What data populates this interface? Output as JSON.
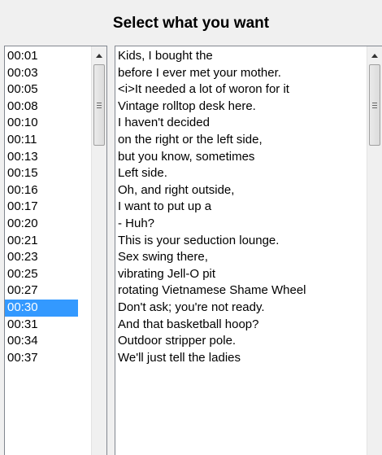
{
  "dialog": {
    "title": "Select what you want"
  },
  "selected_index": 15,
  "times": [
    "00:01",
    "00:03",
    "00:05",
    "00:08",
    "00:10",
    "00:11",
    "00:13",
    "00:15",
    "00:16",
    "00:17",
    "00:20",
    "00:21",
    "00:23",
    "00:25",
    "00:27",
    "00:30",
    "00:31",
    "00:34",
    "00:37"
  ],
  "lines": [
    "Kids, I bought the",
    "before I ever met your mother.",
    "<i>It needed a lot of woron for it",
    "Vintage rolltop desk here.",
    "I haven't decided",
    "on the right or the left side,",
    "but you know, sometimes",
    "Left side.",
    "Oh, and right outside,",
    "I want to put up a",
    "- Huh?",
    "This is your seduction lounge.",
    "Sex swing there,",
    "vibrating Jell-O pit",
    "rotating Vietnamese Shame Wheel",
    "Don't ask; you're not ready.",
    "And that basketball hoop?",
    "Outdoor stripper pole.",
    "We'll just tell the ladies"
  ],
  "colors": {
    "selection": "#3399ff",
    "background": "#f0f0f0"
  },
  "icons": {
    "scroll_up": "arrow-up-icon",
    "thumb_grip": "grip-icon"
  }
}
